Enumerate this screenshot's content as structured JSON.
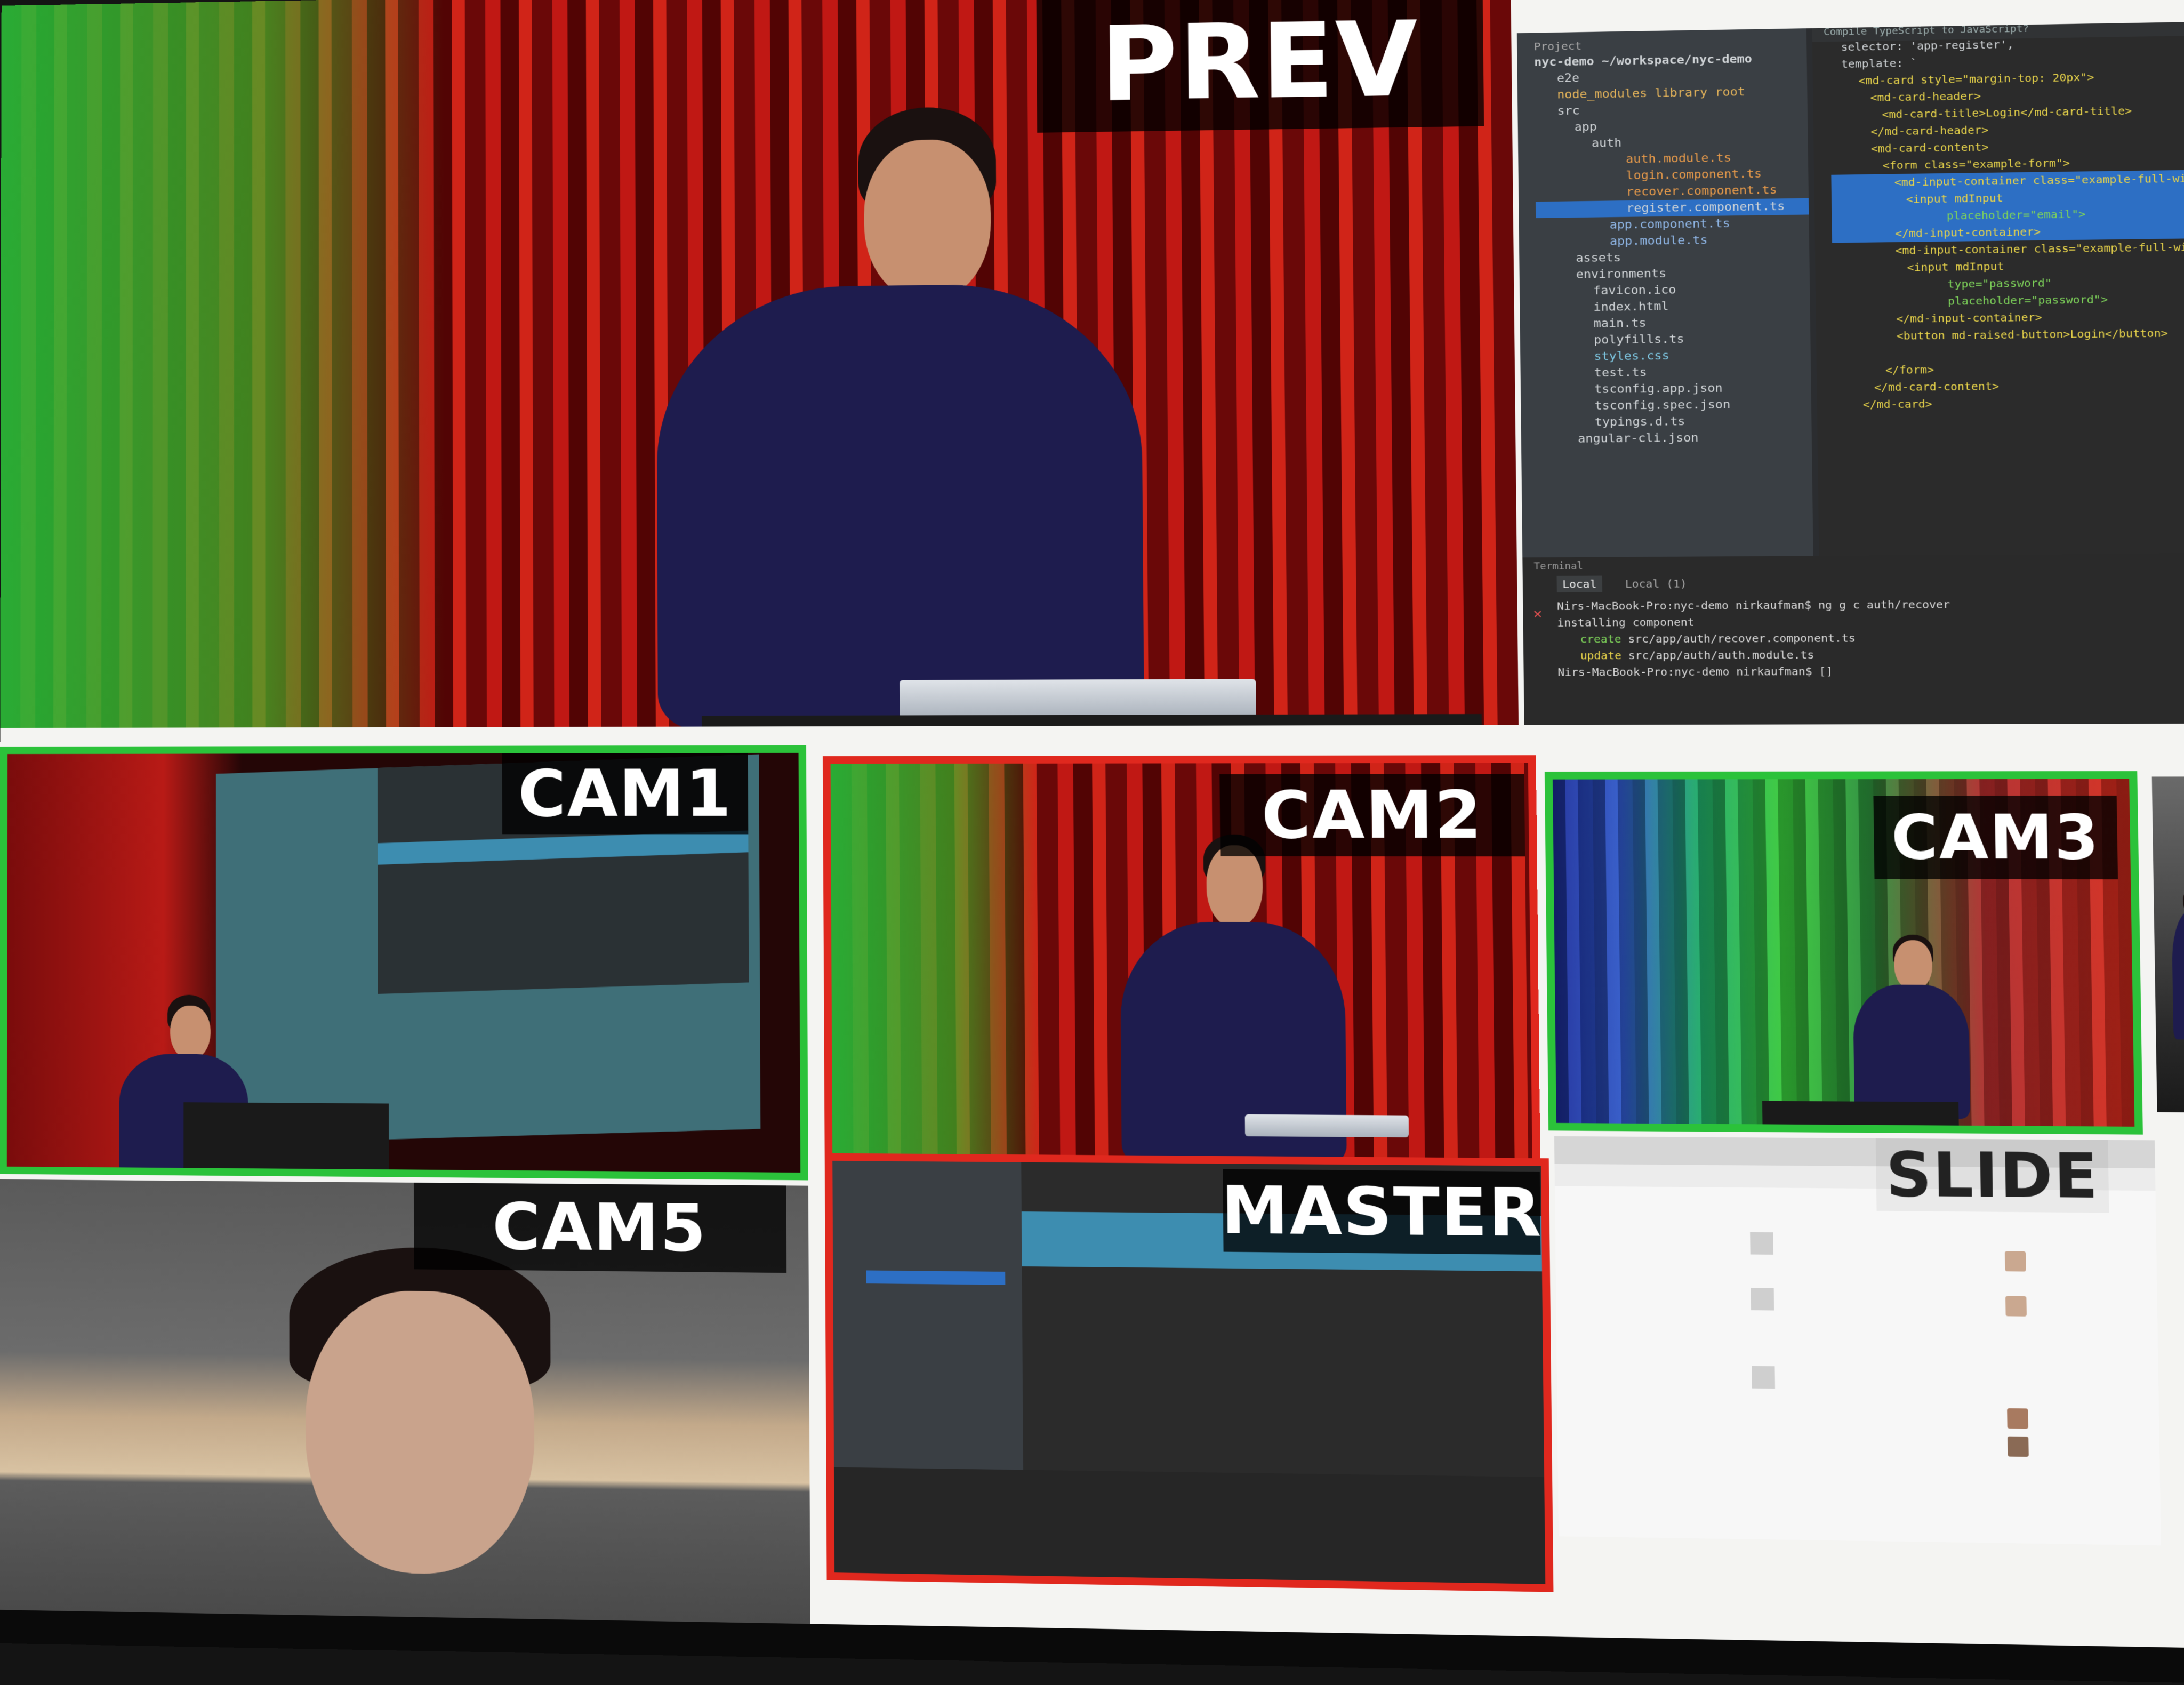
{
  "tiles": {
    "prev": {
      "label": "PREV"
    },
    "cam1": {
      "label": "CAM1"
    },
    "cam2": {
      "label": "CAM2"
    },
    "cam3": {
      "label": "CAM3"
    },
    "cam5": {
      "label": "CAM5"
    },
    "master": {
      "label": "MASTER"
    },
    "slide": {
      "label": "SLIDE"
    }
  },
  "ide": {
    "project_header": "Project",
    "root": "nyc-demo  ~/workspace/nyc-demo",
    "tree": [
      "e2e",
      "node_modules  library root",
      "src",
      "app",
      "auth",
      "auth.module.ts",
      "login.component.ts",
      "recover.component.ts",
      "register.component.ts",
      "app.component.ts",
      "app.module.ts",
      "assets",
      "environments",
      "favicon.ico",
      "index.html",
      "main.ts",
      "polyfills.ts",
      "styles.css",
      "test.ts",
      "tsconfig.app.json",
      "tsconfig.spec.json",
      "typings.d.ts",
      "angular-cli.json"
    ],
    "code": [
      "selector: 'app-register',",
      "template: `",
      "<md-card style=\"margin-top: 20px\">",
      "<md-card-header>",
      "<md-card-title>Login</md-card-title>",
      "</md-card-header>",
      "<md-card-content>",
      "<form class=\"example-form\">",
      "<md-input-container class=\"example-full-width\">",
      "<input mdInput",
      "placeholder=\"email\">",
      "</md-input-container>",
      "<md-input-container class=\"example-full-width\">",
      "<input mdInput",
      "type=\"password\"",
      "placeholder=\"password\">",
      "</md-input-container>",
      "<button md-raised-button>Login</button>",
      "",
      "</form>",
      "</md-card-content>",
      "</md-card>"
    ],
    "hint": "Compile TypeScript to JavaScript?",
    "terminal_header": "Terminal",
    "terminal_tabs": [
      "Local",
      "Local (1)"
    ],
    "terminal": {
      "line1": "Nirs-MacBook-Pro:nyc-demo nirkaufman$ ng g c auth/recover",
      "line2": "installing component",
      "create_kw": "create",
      "create_path": "src/app/auth/recover.component.ts",
      "update_kw": "update",
      "update_path": "src/app/auth/auth.module.ts",
      "line5": "Nirs-MacBook-Pro:nyc-demo nirkaufman$ []"
    }
  },
  "colors": {
    "program_tally": "#e0281e",
    "preview_tally": "#2bc23a",
    "selection": "#2d6fc4"
  }
}
